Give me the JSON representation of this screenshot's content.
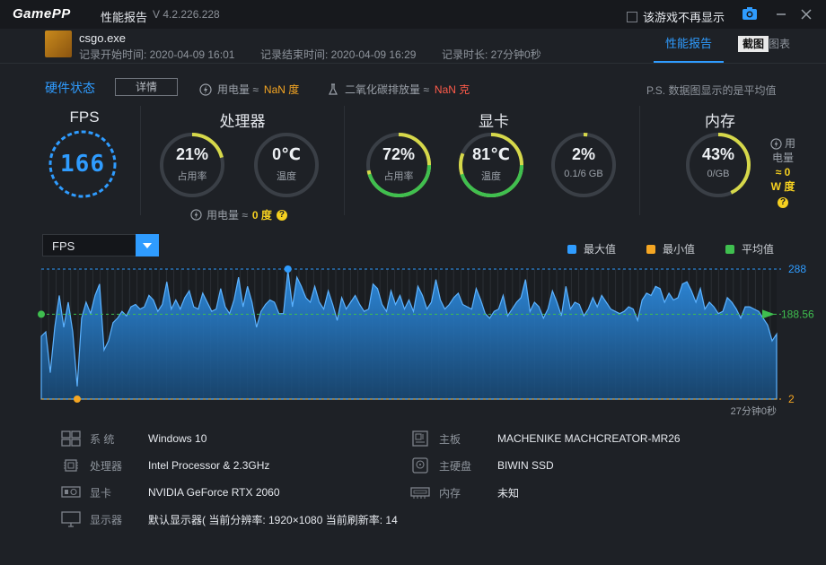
{
  "app": {
    "logo": "GamePP",
    "title": "性能报告",
    "version": "V 4.2.226.228",
    "no_show_label": "该游戏不再显示"
  },
  "record": {
    "process": "csgo.exe",
    "start": "记录开始时间: 2020-04-09 16:01",
    "end": "记录结束时间: 2020-04-09 16:29",
    "duration": "记录时长: 27分钟0秒"
  },
  "tabs": {
    "report": "性能报告",
    "screenshot": "截图",
    "chart": "图表"
  },
  "hardware": {
    "title": "硬件状态",
    "detail_button": "详情",
    "power_label": "用电量 ≈",
    "power_value": "NaN 度",
    "co2_label": "二氧化碳排放量 ≈",
    "co2_value": "NaN 克",
    "note": "P.S. 数据图显示的是平均值"
  },
  "fps": {
    "title": "FPS",
    "value": "166"
  },
  "cpu": {
    "title": "处理器",
    "usage": "21%",
    "usage_label": "占用率",
    "usage_fraction": 0.21,
    "temp": "0℃",
    "temp_label": "温度",
    "temp_fraction": 0.0,
    "power_label": "用电量 ≈",
    "power_value": "0 度"
  },
  "gpu": {
    "title": "显卡",
    "usage": "72%",
    "usage_label": "占用率",
    "usage_fraction": 0.72,
    "temp": "81℃",
    "temp_label": "温度",
    "temp_fraction": 0.81,
    "vram": "2%",
    "vram_label": "0.1/6 GB",
    "vram_fraction": 0.02
  },
  "mem": {
    "title": "内存",
    "usage": "43%",
    "usage_label": "0/GB",
    "usage_fraction": 0.43,
    "power_line1": "用",
    "power_line2": "电量",
    "power_line3": "≈ 0",
    "power_line4": "W 度"
  },
  "chart_controls": {
    "selected": "FPS",
    "legend": [
      {
        "label": "最大值",
        "color": "#2f9cff"
      },
      {
        "label": "最小值",
        "color": "#f5a623"
      },
      {
        "label": "平均值",
        "color": "#3fbf4f"
      }
    ]
  },
  "chart_data": {
    "type": "area",
    "series": [
      {
        "values": [
          140,
          150,
          60,
          160,
          230,
          160,
          215,
          150,
          30,
          180,
          215,
          190,
          230,
          255,
          110,
          130,
          170,
          180,
          195,
          185,
          205,
          210,
          200,
          205,
          230,
          220,
          195,
          210,
          260,
          200,
          220,
          200,
          225,
          240,
          205,
          200,
          235,
          215,
          195,
          200,
          245,
          205,
          190,
          220,
          270,
          205,
          250,
          215,
          160,
          195,
          210,
          220,
          215,
          190,
          190,
          285,
          205,
          270,
          250,
          225,
          215,
          250,
          215,
          200,
          240,
          210,
          175,
          225,
          200,
          215,
          230,
          210,
          195,
          200,
          255,
          245,
          210,
          195,
          240,
          210,
          230,
          200,
          220,
          195,
          250,
          230,
          200,
          215,
          265,
          220,
          200,
          210,
          225,
          235,
          210,
          205,
          200,
          245,
          220,
          190,
          180,
          195,
          200,
          230,
          185,
          200,
          215,
          225,
          265,
          195,
          215,
          205,
          180,
          200,
          240,
          215,
          185,
          250,
          200,
          215,
          210,
          185,
          200,
          225,
          205,
          230,
          215,
          200,
          195,
          190,
          195,
          205,
          200,
          175,
          220,
          235,
          230,
          250,
          245,
          215,
          235,
          220,
          225,
          255,
          260,
          240,
          215,
          245,
          200,
          215,
          205,
          190,
          195,
          225,
          215,
          200,
          180,
          205,
          205,
          200,
          195,
          180,
          165,
          130,
          145
        ]
      }
    ],
    "max": 288,
    "min": 2,
    "avg": 188.56,
    "ylabels": [
      "288",
      "188.56",
      "2"
    ],
    "xlabel_end": "27分钟0秒",
    "ylim": [
      2,
      288
    ]
  },
  "sysinfo": {
    "os_label": "系  统",
    "os_value": "Windows 10",
    "cpu_label": "处理器",
    "cpu_value": "Intel Processor & 2.3GHz",
    "gpu_label": "显卡",
    "gpu_value": "NVIDIA GeForce RTX 2060",
    "display_label": "显示器",
    "display_value": "默认显示器( 当前分辨率: 1920×1080 当前刷新率: 14",
    "board_label": "主板",
    "board_value": "MACHENIKE MACHCREATOR-MR26",
    "disk_label": "主硬盘",
    "disk_value": "BIWIN SSD",
    "ram_label": "内存",
    "ram_value": "未知"
  }
}
